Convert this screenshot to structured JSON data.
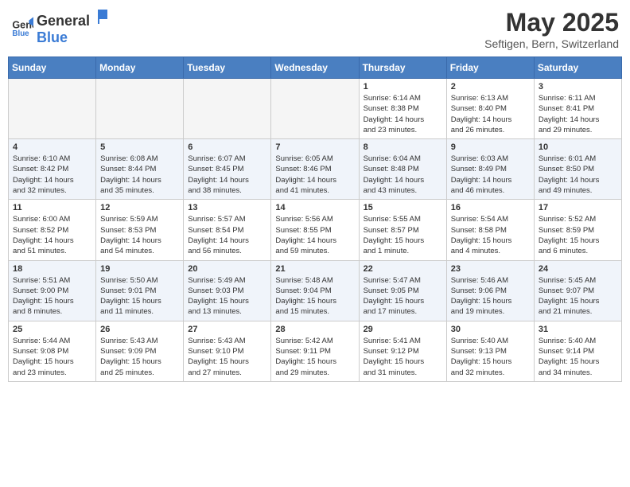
{
  "header": {
    "logo_general": "General",
    "logo_blue": "Blue",
    "title": "May 2025",
    "subtitle": "Seftigen, Bern, Switzerland"
  },
  "weekdays": [
    "Sunday",
    "Monday",
    "Tuesday",
    "Wednesday",
    "Thursday",
    "Friday",
    "Saturday"
  ],
  "weeks": [
    [
      {
        "day": "",
        "info": ""
      },
      {
        "day": "",
        "info": ""
      },
      {
        "day": "",
        "info": ""
      },
      {
        "day": "",
        "info": ""
      },
      {
        "day": "1",
        "info": "Sunrise: 6:14 AM\nSunset: 8:38 PM\nDaylight: 14 hours\nand 23 minutes."
      },
      {
        "day": "2",
        "info": "Sunrise: 6:13 AM\nSunset: 8:40 PM\nDaylight: 14 hours\nand 26 minutes."
      },
      {
        "day": "3",
        "info": "Sunrise: 6:11 AM\nSunset: 8:41 PM\nDaylight: 14 hours\nand 29 minutes."
      }
    ],
    [
      {
        "day": "4",
        "info": "Sunrise: 6:10 AM\nSunset: 8:42 PM\nDaylight: 14 hours\nand 32 minutes."
      },
      {
        "day": "5",
        "info": "Sunrise: 6:08 AM\nSunset: 8:44 PM\nDaylight: 14 hours\nand 35 minutes."
      },
      {
        "day": "6",
        "info": "Sunrise: 6:07 AM\nSunset: 8:45 PM\nDaylight: 14 hours\nand 38 minutes."
      },
      {
        "day": "7",
        "info": "Sunrise: 6:05 AM\nSunset: 8:46 PM\nDaylight: 14 hours\nand 41 minutes."
      },
      {
        "day": "8",
        "info": "Sunrise: 6:04 AM\nSunset: 8:48 PM\nDaylight: 14 hours\nand 43 minutes."
      },
      {
        "day": "9",
        "info": "Sunrise: 6:03 AM\nSunset: 8:49 PM\nDaylight: 14 hours\nand 46 minutes."
      },
      {
        "day": "10",
        "info": "Sunrise: 6:01 AM\nSunset: 8:50 PM\nDaylight: 14 hours\nand 49 minutes."
      }
    ],
    [
      {
        "day": "11",
        "info": "Sunrise: 6:00 AM\nSunset: 8:52 PM\nDaylight: 14 hours\nand 51 minutes."
      },
      {
        "day": "12",
        "info": "Sunrise: 5:59 AM\nSunset: 8:53 PM\nDaylight: 14 hours\nand 54 minutes."
      },
      {
        "day": "13",
        "info": "Sunrise: 5:57 AM\nSunset: 8:54 PM\nDaylight: 14 hours\nand 56 minutes."
      },
      {
        "day": "14",
        "info": "Sunrise: 5:56 AM\nSunset: 8:55 PM\nDaylight: 14 hours\nand 59 minutes."
      },
      {
        "day": "15",
        "info": "Sunrise: 5:55 AM\nSunset: 8:57 PM\nDaylight: 15 hours\nand 1 minute."
      },
      {
        "day": "16",
        "info": "Sunrise: 5:54 AM\nSunset: 8:58 PM\nDaylight: 15 hours\nand 4 minutes."
      },
      {
        "day": "17",
        "info": "Sunrise: 5:52 AM\nSunset: 8:59 PM\nDaylight: 15 hours\nand 6 minutes."
      }
    ],
    [
      {
        "day": "18",
        "info": "Sunrise: 5:51 AM\nSunset: 9:00 PM\nDaylight: 15 hours\nand 8 minutes."
      },
      {
        "day": "19",
        "info": "Sunrise: 5:50 AM\nSunset: 9:01 PM\nDaylight: 15 hours\nand 11 minutes."
      },
      {
        "day": "20",
        "info": "Sunrise: 5:49 AM\nSunset: 9:03 PM\nDaylight: 15 hours\nand 13 minutes."
      },
      {
        "day": "21",
        "info": "Sunrise: 5:48 AM\nSunset: 9:04 PM\nDaylight: 15 hours\nand 15 minutes."
      },
      {
        "day": "22",
        "info": "Sunrise: 5:47 AM\nSunset: 9:05 PM\nDaylight: 15 hours\nand 17 minutes."
      },
      {
        "day": "23",
        "info": "Sunrise: 5:46 AM\nSunset: 9:06 PM\nDaylight: 15 hours\nand 19 minutes."
      },
      {
        "day": "24",
        "info": "Sunrise: 5:45 AM\nSunset: 9:07 PM\nDaylight: 15 hours\nand 21 minutes."
      }
    ],
    [
      {
        "day": "25",
        "info": "Sunrise: 5:44 AM\nSunset: 9:08 PM\nDaylight: 15 hours\nand 23 minutes."
      },
      {
        "day": "26",
        "info": "Sunrise: 5:43 AM\nSunset: 9:09 PM\nDaylight: 15 hours\nand 25 minutes."
      },
      {
        "day": "27",
        "info": "Sunrise: 5:43 AM\nSunset: 9:10 PM\nDaylight: 15 hours\nand 27 minutes."
      },
      {
        "day": "28",
        "info": "Sunrise: 5:42 AM\nSunset: 9:11 PM\nDaylight: 15 hours\nand 29 minutes."
      },
      {
        "day": "29",
        "info": "Sunrise: 5:41 AM\nSunset: 9:12 PM\nDaylight: 15 hours\nand 31 minutes."
      },
      {
        "day": "30",
        "info": "Sunrise: 5:40 AM\nSunset: 9:13 PM\nDaylight: 15 hours\nand 32 minutes."
      },
      {
        "day": "31",
        "info": "Sunrise: 5:40 AM\nSunset: 9:14 PM\nDaylight: 15 hours\nand 34 minutes."
      }
    ]
  ]
}
